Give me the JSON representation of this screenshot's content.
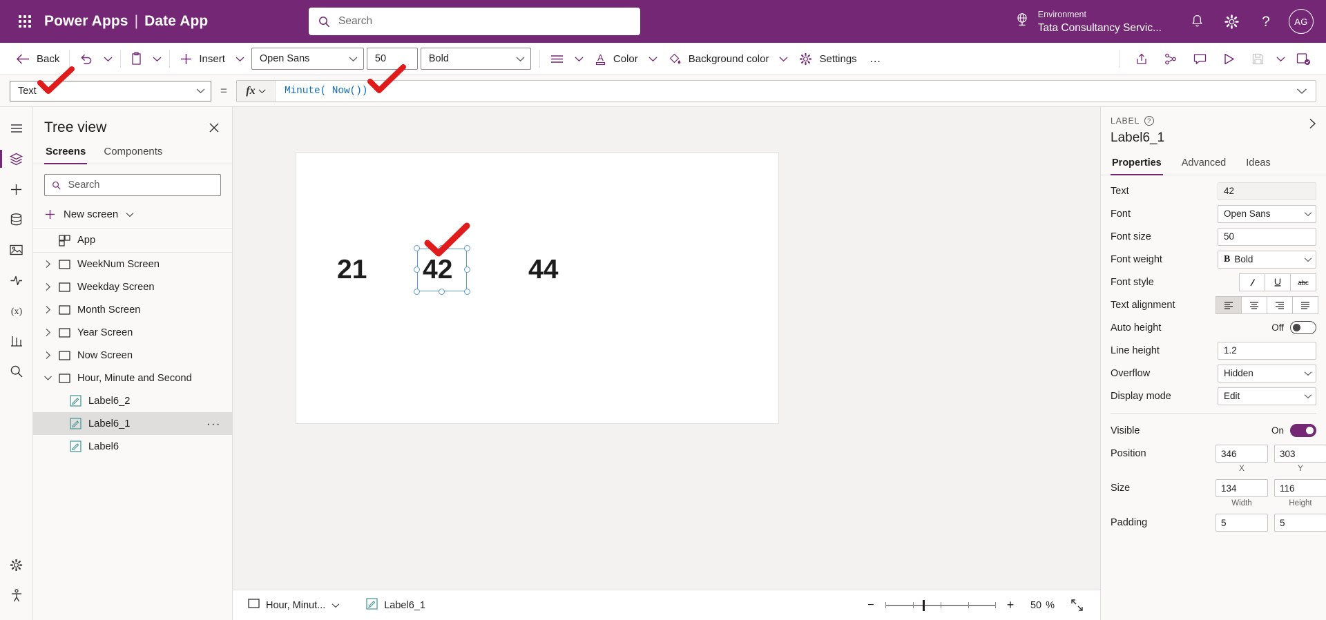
{
  "topbar": {
    "waffle": "app-launcher",
    "brand": "Power Apps",
    "separator": "|",
    "app_name": "Date App",
    "search_placeholder": "Search",
    "environment_label": "Environment",
    "environment_name": "Tata Consultancy Servic...",
    "notification_icon": "bell-icon",
    "settings_icon": "gear-icon",
    "help_icon": "help-icon",
    "avatar_initials": "AG",
    "brand_color": "#742774"
  },
  "commandbar": {
    "back": "Back",
    "undo": "undo-icon",
    "paste": "paste-icon",
    "insert": "Insert",
    "font": "Open Sans",
    "font_size": "50",
    "font_weight": "Bold",
    "align_icon": "align-left-icon",
    "color": "Color",
    "background_color": "Background color",
    "settings": "Settings",
    "overflow": "…",
    "right_icons": [
      "share-icon",
      "checker-icon",
      "comments-icon",
      "play-icon",
      "save-icon",
      "save-chevron",
      "publish-icon"
    ]
  },
  "formulabar": {
    "property": "Text",
    "equals": "=",
    "fx": "fx",
    "formula": "Minute( Now())",
    "expand_icon": "chevron-down-icon"
  },
  "rail": {
    "items": [
      {
        "name": "menu-icon",
        "active": false
      },
      {
        "name": "tree-view-icon",
        "active": true
      },
      {
        "name": "insert-icon",
        "active": false
      },
      {
        "name": "data-icon",
        "active": false
      },
      {
        "name": "media-icon",
        "active": false
      },
      {
        "name": "power-automate-icon",
        "active": false
      },
      {
        "name": "variables-icon",
        "active": false
      },
      {
        "name": "app-checker-icon",
        "active": false
      },
      {
        "name": "search-icon",
        "active": false
      }
    ],
    "bottom": [
      {
        "name": "settings-icon"
      },
      {
        "name": "accessibility-icon"
      }
    ]
  },
  "treeview": {
    "title": "Tree view",
    "close_icon": "close-icon",
    "tabs": [
      {
        "label": "Screens",
        "selected": true
      },
      {
        "label": "Components",
        "selected": false
      }
    ],
    "search_placeholder": "Search",
    "new_screen": "New screen",
    "app_item": "App",
    "items": [
      {
        "label": "WeekNum Screen",
        "expanded": false,
        "level": 0,
        "type": "screen"
      },
      {
        "label": "Weekday Screen",
        "expanded": false,
        "level": 0,
        "type": "screen"
      },
      {
        "label": "Month Screen",
        "expanded": false,
        "level": 0,
        "type": "screen"
      },
      {
        "label": "Year Screen",
        "expanded": false,
        "level": 0,
        "type": "screen"
      },
      {
        "label": "Now Screen",
        "expanded": false,
        "level": 0,
        "type": "screen"
      },
      {
        "label": "Hour, Minute and Second",
        "expanded": true,
        "level": 0,
        "type": "screen"
      },
      {
        "label": "Label6_2",
        "expanded": null,
        "level": 1,
        "type": "label"
      },
      {
        "label": "Label6_1",
        "expanded": null,
        "level": 1,
        "type": "label",
        "selected": true,
        "overflow": "···"
      },
      {
        "label": "Label6",
        "expanded": null,
        "level": 1,
        "type": "label"
      }
    ]
  },
  "canvas": {
    "labels": [
      {
        "name": "label6-hour",
        "value": "21"
      },
      {
        "name": "label6_1-minute",
        "value": "42",
        "selected": true
      },
      {
        "name": "label6_2-second",
        "value": "44"
      }
    ],
    "annotation_color": "#e01b1b"
  },
  "statusbar": {
    "screen_crumb": "Hour, Minut...",
    "control_crumb": "Label6_1",
    "zoom_out": "−",
    "zoom_in": "+",
    "zoom_value": "50",
    "zoom_unit": "%",
    "fit_icon": "fit-screen-icon"
  },
  "properties": {
    "type_label": "LABEL",
    "help_icon": "help-icon",
    "name": "Label6_1",
    "collapse_icon": "chevron-right-icon",
    "tabs": [
      {
        "label": "Properties",
        "selected": true
      },
      {
        "label": "Advanced",
        "selected": false
      },
      {
        "label": "Ideas",
        "selected": false
      }
    ],
    "fields": [
      {
        "label": "Text",
        "type": "readonly",
        "value": "42"
      },
      {
        "label": "Font",
        "type": "select",
        "value": "Open Sans"
      },
      {
        "label": "Font size",
        "type": "input",
        "value": "50"
      },
      {
        "label": "Font weight",
        "type": "select",
        "value": "Bold",
        "prefix": "B"
      },
      {
        "label": "Font style",
        "type": "buttons",
        "buttons": [
          "italic-icon",
          "underline-icon",
          "strikethrough-icon"
        ]
      },
      {
        "label": "Text alignment",
        "type": "buttons",
        "buttons": [
          "align-left-icon",
          "align-center-icon",
          "align-right-icon",
          "align-justify-icon"
        ],
        "active": 0
      },
      {
        "label": "Auto height",
        "type": "toggle",
        "state": "Off",
        "on": false
      },
      {
        "label": "Line height",
        "type": "input",
        "value": "1.2"
      },
      {
        "label": "Overflow",
        "type": "select",
        "value": "Hidden"
      },
      {
        "label": "Display mode",
        "type": "select",
        "value": "Edit"
      }
    ],
    "visible": {
      "label": "Visible",
      "state": "On",
      "on": true
    },
    "position": {
      "label": "Position",
      "x": "346",
      "y": "303",
      "x_sub": "X",
      "y_sub": "Y"
    },
    "size": {
      "label": "Size",
      "width": "134",
      "height": "116",
      "w_sub": "Width",
      "h_sub": "Height"
    },
    "padding": {
      "label": "Padding",
      "a": "5",
      "b": "5"
    }
  }
}
